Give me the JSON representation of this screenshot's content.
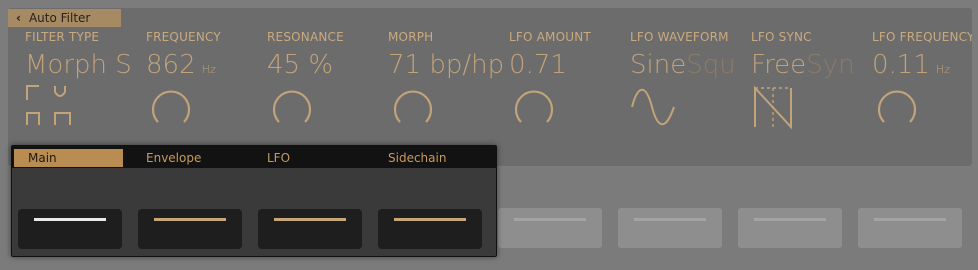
{
  "back_button": {
    "label": "Auto Filter"
  },
  "params": [
    {
      "label": "FILTER TYPE",
      "value": "Morph S",
      "value_dim": "",
      "unit": ""
    },
    {
      "label": "FREQUENCY",
      "value": "862",
      "value_dim": "",
      "unit": "Hz"
    },
    {
      "label": "RESONANCE",
      "value": "45 %",
      "value_dim": "",
      "unit": ""
    },
    {
      "label": "MORPH",
      "value": "71 bp/hp",
      "value_dim": "",
      "unit": ""
    },
    {
      "label": "LFO AMOUNT",
      "value": "0.71",
      "value_dim": "",
      "unit": ""
    },
    {
      "label": "LFO WAVEFORM",
      "value": "Sine",
      "value_dim": "Squ",
      "unit": ""
    },
    {
      "label": "LFO SYNC",
      "value": "Free",
      "value_dim": "Syn",
      "unit": ""
    },
    {
      "label": "LFO FREQUENCY",
      "value": "0.11",
      "value_dim": "",
      "unit": "Hz"
    }
  ],
  "knob_levels": {
    "frequency": 0.62,
    "resonance": 0.45,
    "morph": 0.71,
    "lfo_amount": 0.71,
    "lfo_frequency": 0.55
  },
  "tabs": [
    {
      "label": "Main"
    },
    {
      "label": "Envelope"
    },
    {
      "label": "LFO"
    },
    {
      "label": "Sidechain"
    }
  ],
  "colors": {
    "accent": "#b98d51",
    "label": "#c9aa7e",
    "value": "#c2a37a"
  },
  "icons": {
    "filter_type": "filter-shape-icon",
    "lfo_waveform": "sine-wave-icon",
    "lfo_sync": "sync-wave-icon"
  }
}
